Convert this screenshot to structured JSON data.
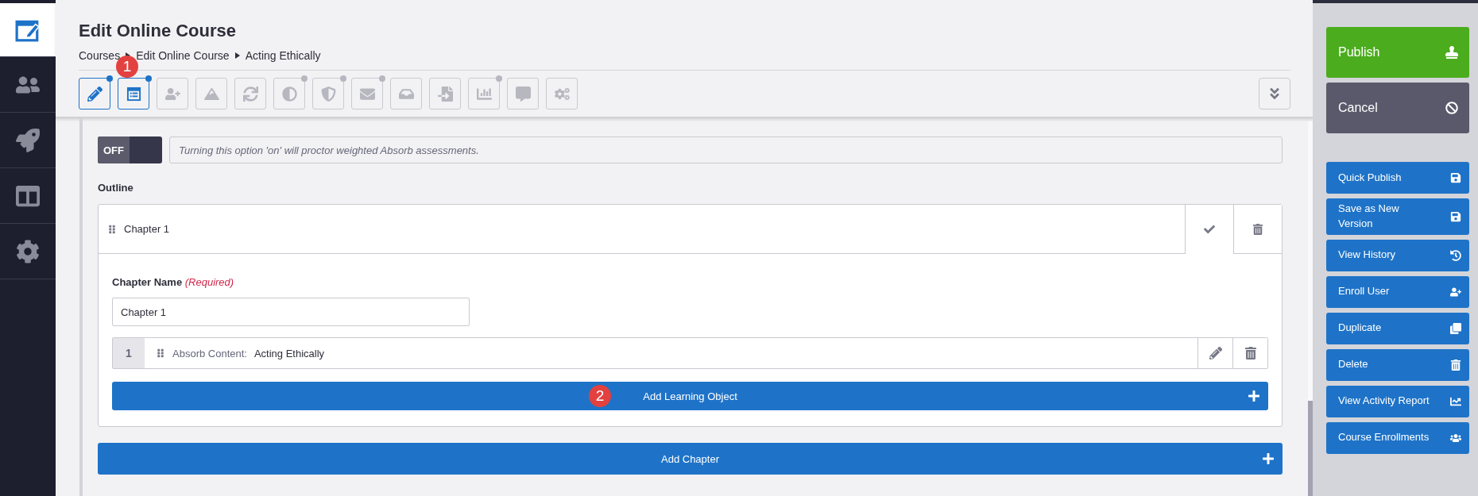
{
  "sidebar": {
    "items": [
      {
        "selected": true
      },
      {
        "selected": false
      },
      {
        "selected": false
      },
      {
        "selected": false
      },
      {
        "selected": false
      }
    ]
  },
  "header": {
    "title": "Edit Online Course",
    "breadcrumb": [
      "Courses",
      "Edit Online Course",
      "Acting Ethically"
    ]
  },
  "toolbar": {
    "items": [
      {
        "active": true,
        "dot": true
      },
      {
        "active": true,
        "dot": true,
        "badge": "1"
      },
      {
        "active": false,
        "dot": false
      },
      {
        "active": false,
        "dot": false
      },
      {
        "active": false,
        "dot": false
      },
      {
        "active": false,
        "dot": true
      },
      {
        "active": false,
        "dot": true
      },
      {
        "active": false,
        "dot": true
      },
      {
        "active": false,
        "dot": false
      },
      {
        "active": false,
        "dot": false
      },
      {
        "active": false,
        "dot": true
      },
      {
        "active": false,
        "dot": false
      },
      {
        "active": false,
        "dot": false
      }
    ]
  },
  "proctor": {
    "toggle": {
      "on": false,
      "label": "OFF"
    },
    "description": "Turning this option 'on' will proctor weighted Absorb assessments."
  },
  "outline": {
    "label": "Outline",
    "chapters": [
      {
        "title": "Chapter 1",
        "expanded": true,
        "name_label": "Chapter Name",
        "required": "(Required)",
        "name_value": "Chapter 1",
        "learning_objects": [
          {
            "number": "1",
            "type": "Absorb Content:",
            "name": "Acting Ethically"
          }
        ],
        "add_button": {
          "label": "Add Learning Object",
          "badge": "2"
        }
      }
    ],
    "add_chapter": "Add Chapter"
  },
  "actions": {
    "primary": [
      {
        "label": "Publish",
        "kind": "publish"
      },
      {
        "label": "Cancel",
        "kind": "cancel"
      }
    ],
    "secondary": [
      "Quick Publish",
      "Save as New Version",
      "View History",
      "Enroll User",
      "Duplicate",
      "Delete",
      "View Activity Report",
      "Course Enrollments"
    ]
  }
}
